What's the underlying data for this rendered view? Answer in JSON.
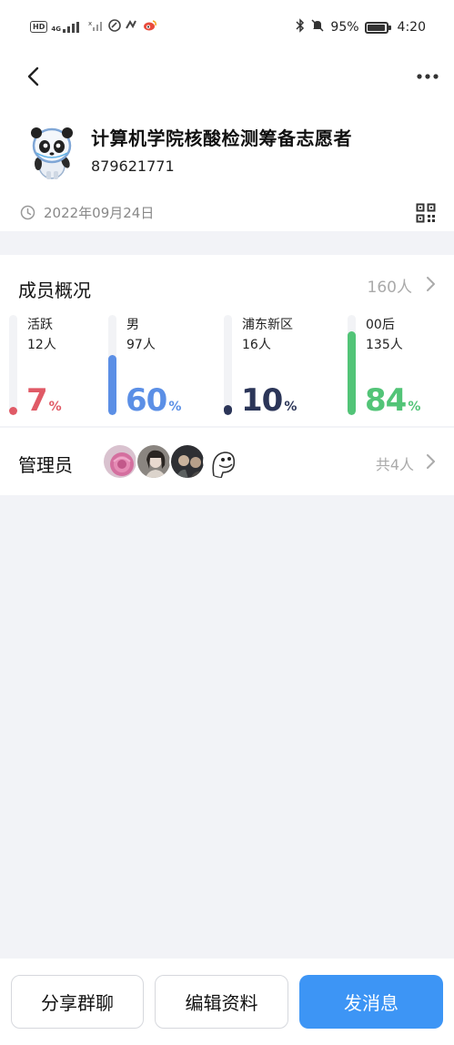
{
  "status_bar": {
    "network_badge": "HD",
    "signal_label": "4G",
    "battery_percent": "95%",
    "time": "4:20"
  },
  "group": {
    "name": "计算机学院核酸检测筹备志愿者",
    "id": "879621771",
    "date": "2022年09月24日"
  },
  "members": {
    "title": "成员概况",
    "count": "160人",
    "stats": [
      {
        "label": "活跃",
        "count": "12人",
        "percent": "7",
        "percent_sign": "%",
        "fraction": 0.07,
        "color": "#e05a66"
      },
      {
        "label": "男",
        "count": "97人",
        "percent": "60",
        "percent_sign": "%",
        "fraction": 0.6,
        "color": "#5b8fe6"
      },
      {
        "label": "浦东新区",
        "count": "16人",
        "percent": "10",
        "percent_sign": "%",
        "fraction": 0.1,
        "color": "#2b3558"
      },
      {
        "label": "00后",
        "count": "135人",
        "percent": "84",
        "percent_sign": "%",
        "fraction": 0.84,
        "color": "#52c477"
      }
    ]
  },
  "admins": {
    "title": "管理员",
    "total": "共4人"
  },
  "actions": {
    "share": "分享群聊",
    "edit": "编辑资料",
    "message": "发消息"
  },
  "colors": {
    "primary": "#3d95f5",
    "muted_text": "#aaaaaa"
  }
}
